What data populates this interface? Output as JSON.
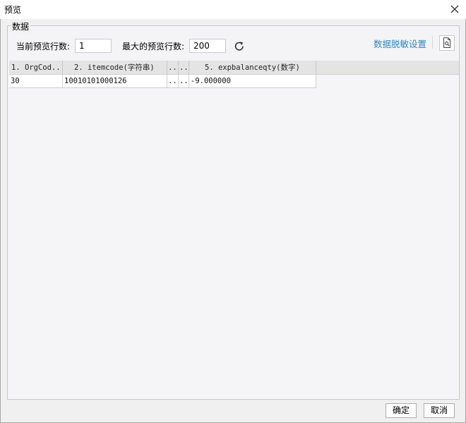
{
  "window": {
    "title": "预览"
  },
  "group": {
    "legend": "数据"
  },
  "controls": {
    "current_rows_label": "当前预览行数:",
    "current_rows_value": "1",
    "max_rows_label": "最大的预览行数:",
    "max_rows_value": "200",
    "desensitize_link": "数据脱敏设置"
  },
  "table": {
    "columns": [
      "1. OrgCod...",
      "2. itemcode(字符串)",
      "..",
      "..",
      "5. expbalanceqty(数字)"
    ],
    "rows": [
      [
        "30",
        "10010101000126",
        "..",
        "..",
        "-9.000000"
      ]
    ]
  },
  "footer": {
    "ok_label": "确定",
    "cancel_label": "取消"
  }
}
